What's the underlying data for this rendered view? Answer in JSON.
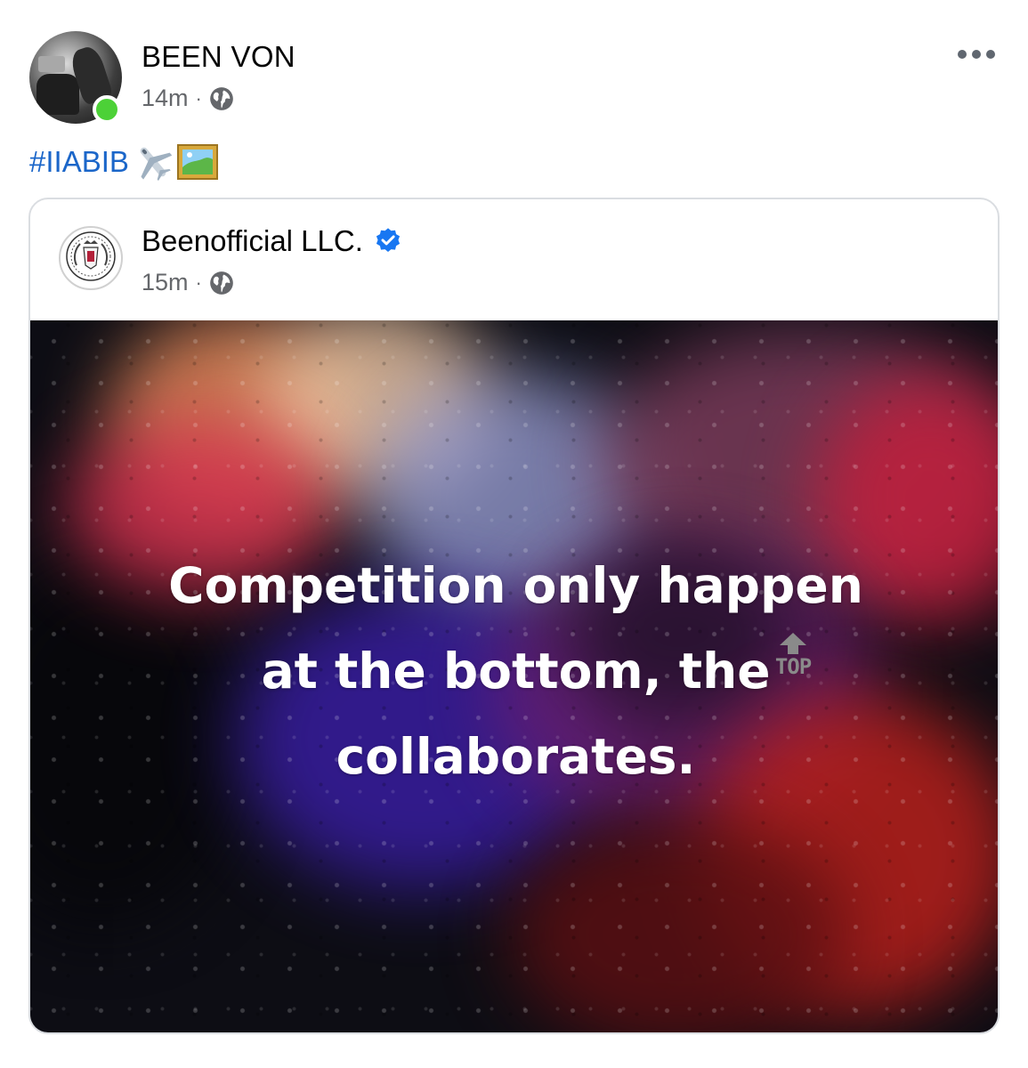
{
  "post": {
    "author": "BEEN VON",
    "time": "14m",
    "separator": "·",
    "audience_icon": "globe-icon",
    "online": true,
    "more_icon": "more-horizontal-icon",
    "caption": {
      "hashtag": "#IIABIB",
      "emojis": [
        "airplane-emoji",
        "framed-picture-emoji"
      ]
    }
  },
  "shared_post": {
    "author": "Beenofficial LLC.",
    "verified": true,
    "time": "15m",
    "separator": "·",
    "audience_icon": "globe-icon",
    "logo_icon": "beenofficial-crest-logo",
    "image": {
      "quote_line1": "Competition only happen",
      "quote_line2": "at the bottom, the",
      "quote_line3": "collaborates.",
      "inline_emoji": "top-arrow-emoji",
      "inline_emoji_label": "TOP"
    }
  },
  "colors": {
    "hashtag": "#1b66c9",
    "verified": "#1877f2",
    "online_dot": "#4cd137",
    "meta_text": "#65676b"
  }
}
